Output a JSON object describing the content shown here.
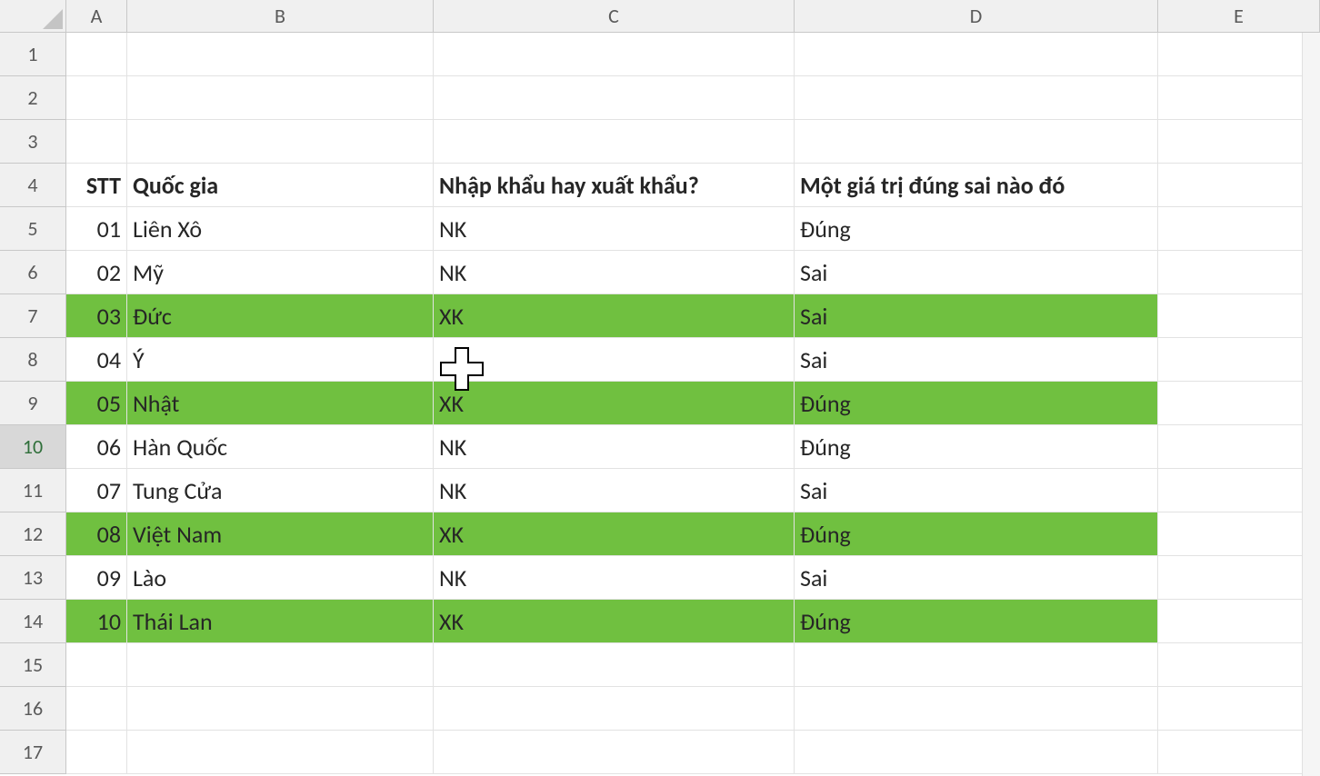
{
  "columns": [
    "A",
    "B",
    "C",
    "D",
    "E"
  ],
  "row_headers": [
    "1",
    "2",
    "3",
    "4",
    "5",
    "6",
    "7",
    "8",
    "9",
    "10",
    "11",
    "12",
    "13",
    "14",
    "15",
    "16",
    "17"
  ],
  "active_row_header_index": 9,
  "headers": {
    "stt": "STT",
    "country": "Quốc gia",
    "importexport": "Nhập khẩu hay xuất khẩu?",
    "truefalse": "Một giá trị đúng sai nào đó"
  },
  "rows": [
    {
      "stt": "01",
      "country": "Liên Xô",
      "ie": "NK",
      "tf": "Đúng",
      "hl": false
    },
    {
      "stt": "02",
      "country": "Mỹ",
      "ie": "NK",
      "tf": "Sai",
      "hl": false
    },
    {
      "stt": "03",
      "country": "Đức",
      "ie": "XK",
      "tf": "Sai",
      "hl": true
    },
    {
      "stt": "04",
      "country": "Ý",
      "ie": "",
      "tf": "Sai",
      "hl": false
    },
    {
      "stt": "05",
      "country": "Nhật",
      "ie": "XK",
      "tf": "Đúng",
      "hl": true
    },
    {
      "stt": "06",
      "country": "Hàn Quốc",
      "ie": "NK",
      "tf": "Đúng",
      "hl": false
    },
    {
      "stt": "07",
      "country": "Tung Cửa",
      "ie": "NK",
      "tf": "Sai",
      "hl": false
    },
    {
      "stt": "08",
      "country": "Việt Nam",
      "ie": "XK",
      "tf": "Đúng",
      "hl": true
    },
    {
      "stt": "09",
      "country": "Lào",
      "ie": "NK",
      "tf": "Sai",
      "hl": false
    },
    {
      "stt": "10",
      "country": "Thái Lan",
      "ie": "XK",
      "tf": "Đúng",
      "hl": true
    }
  ],
  "colors": {
    "highlight": "#70c040",
    "header_bg": "#f0f0f0",
    "grid": "#e2e2e2"
  }
}
